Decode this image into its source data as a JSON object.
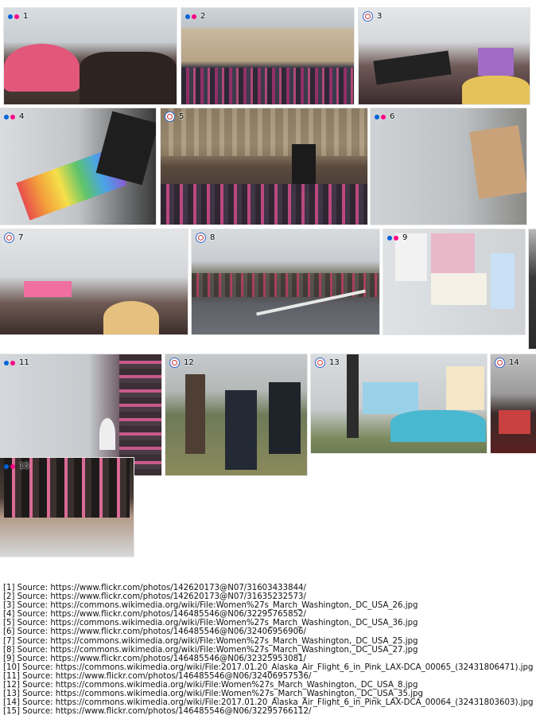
{
  "tiles": [
    {
      "id": "1",
      "icon": "flickr-icon"
    },
    {
      "id": "2",
      "icon": "flickr-icon"
    },
    {
      "id": "3",
      "icon": "wikimedia-icon"
    },
    {
      "id": "4",
      "icon": "flickr-icon"
    },
    {
      "id": "5",
      "icon": "wikimedia-icon"
    },
    {
      "id": "6",
      "icon": "flickr-icon"
    },
    {
      "id": "7",
      "icon": "wikimedia-icon"
    },
    {
      "id": "8",
      "icon": "wikimedia-icon"
    },
    {
      "id": "9",
      "icon": "flickr-icon"
    },
    {
      "id": "11",
      "icon": "flickr-icon"
    },
    {
      "id": "12",
      "icon": "wikimedia-icon"
    },
    {
      "id": "13",
      "icon": "wikimedia-icon"
    },
    {
      "id": "14",
      "icon": "wikimedia-icon"
    },
    {
      "id": "15",
      "icon": "flickr-icon"
    }
  ],
  "sources": [
    "[1] Source: https://www.flickr.com/photos/142620173@N07/31603433844/",
    "[2] Source: https://www.flickr.com/photos/142620173@N07/31635232573/",
    "[3] Source: https://commons.wikimedia.org/wiki/File:Women%27s_March_Washington,_DC_USA_26.jpg",
    "[4] Source: https://www.flickr.com/photos/146485546@N06/32295765852/",
    "[5] Source: https://commons.wikimedia.org/wiki/File:Women%27s_March_Washington,_DC_USA_36.jpg",
    "[6] Source: https://www.flickr.com/photos/146485546@N06/32406956906/",
    "[7] Source: https://commons.wikimedia.org/wiki/File:Women%27s_March_Washington,_DC_USA_25.jpg",
    "[8] Source: https://commons.wikimedia.org/wiki/File:Women%27s_March_Washington,_DC_USA_27.jpg",
    "[9] Source: https://www.flickr.com/photos/146485546@N06/32325953081/",
    "[10] Source: https://commons.wikimedia.org/wiki/File:2017.01.20_Alaska_Air_Flight_6_in_Pink_LAX-DCA_00065_(32431806471).jpg",
    "[11] Source: https://www.flickr.com/photos/146485546@N06/32406957536/",
    "[12] Source: https://commons.wikimedia.org/wiki/File:Women%27s_March_Washington,_DC_USA_8.jpg",
    "[13] Source: https://commons.wikimedia.org/wiki/File:Women%27s_March_Washington,_DC_USA_35.jpg",
    "[14] Source: https://commons.wikimedia.org/wiki/File:2017.01.20_Alaska_Air_Flight_6_in_Pink_LAX-DCA_00064_(32431803603).jpg",
    "[15] Source: https://www.flickr.com/photos/146485546@N06/32295766112/"
  ]
}
